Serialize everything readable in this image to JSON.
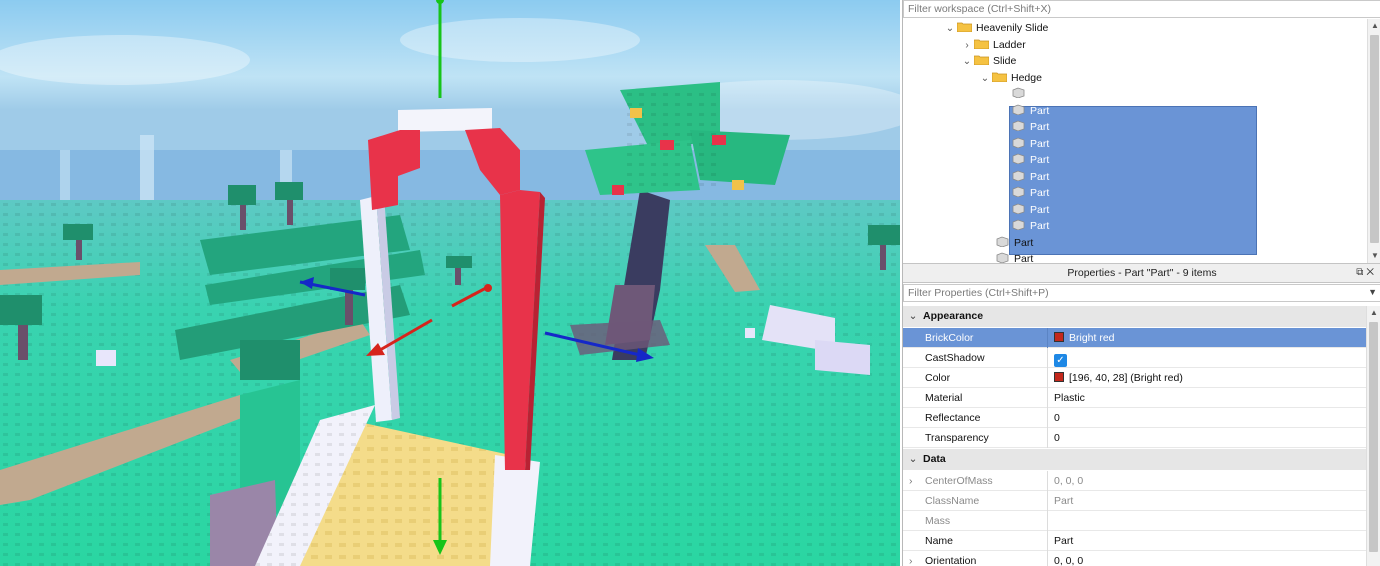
{
  "explorer": {
    "filter_placeholder": "Filter workspace (Ctrl+Shift+X)",
    "tree": [
      {
        "label": "Heavenily Slide",
        "expanded": true,
        "icon": "folder-icon"
      },
      {
        "label": "Ladder",
        "expanded": false,
        "icon": "folder-icon"
      },
      {
        "label": "Slide",
        "expanded": true,
        "icon": "folder-icon"
      },
      {
        "label": "Hedge",
        "expanded": true,
        "icon": "folder-icon"
      },
      {
        "label": "Part",
        "icon": "part-icon",
        "selected": true
      },
      {
        "label": "Part",
        "icon": "part-icon",
        "selected": true
      },
      {
        "label": "Part",
        "icon": "part-icon",
        "selected": true
      },
      {
        "label": "Part",
        "icon": "part-icon",
        "selected": true
      },
      {
        "label": "Part",
        "icon": "part-icon",
        "selected": true
      },
      {
        "label": "Part",
        "icon": "part-icon",
        "selected": true
      },
      {
        "label": "Part",
        "icon": "part-icon",
        "selected": true
      },
      {
        "label": "Part",
        "icon": "part-icon",
        "selected": true
      },
      {
        "label": "Part",
        "icon": "part-icon",
        "selected": true
      },
      {
        "label": "Part",
        "icon": "part-icon",
        "selected": false
      },
      {
        "label": "Part",
        "icon": "part-icon",
        "selected": false
      }
    ]
  },
  "properties": {
    "title": "Properties - Part \"Part\" - 9 items",
    "filter_placeholder": "Filter Properties (Ctrl+Shift+P)",
    "categories": {
      "appearance": "Appearance",
      "data": "Data"
    },
    "appearance": [
      {
        "name": "BrickColor",
        "value": "Bright red",
        "swatch": "#c4281c"
      },
      {
        "name": "CastShadow",
        "value": "✓"
      },
      {
        "name": "Color",
        "value": "[196, 40, 28] (Bright red)",
        "swatch": "#c4281c"
      },
      {
        "name": "Material",
        "value": "Plastic"
      },
      {
        "name": "Reflectance",
        "value": "0"
      },
      {
        "name": "Transparency",
        "value": "0"
      }
    ],
    "data": [
      {
        "name": "CenterOfMass",
        "value": "0, 0, 0"
      },
      {
        "name": "ClassName",
        "value": "Part"
      },
      {
        "name": "Mass",
        "value": ""
      },
      {
        "name": "Name",
        "value": "Part"
      },
      {
        "name": "Orientation",
        "value": "0, 0, 0"
      }
    ]
  },
  "colors": {
    "selection": "#6a94d6",
    "sky": "#9fd3f0",
    "ground": "#2fd7a8",
    "brick_red": "#e8334a"
  }
}
